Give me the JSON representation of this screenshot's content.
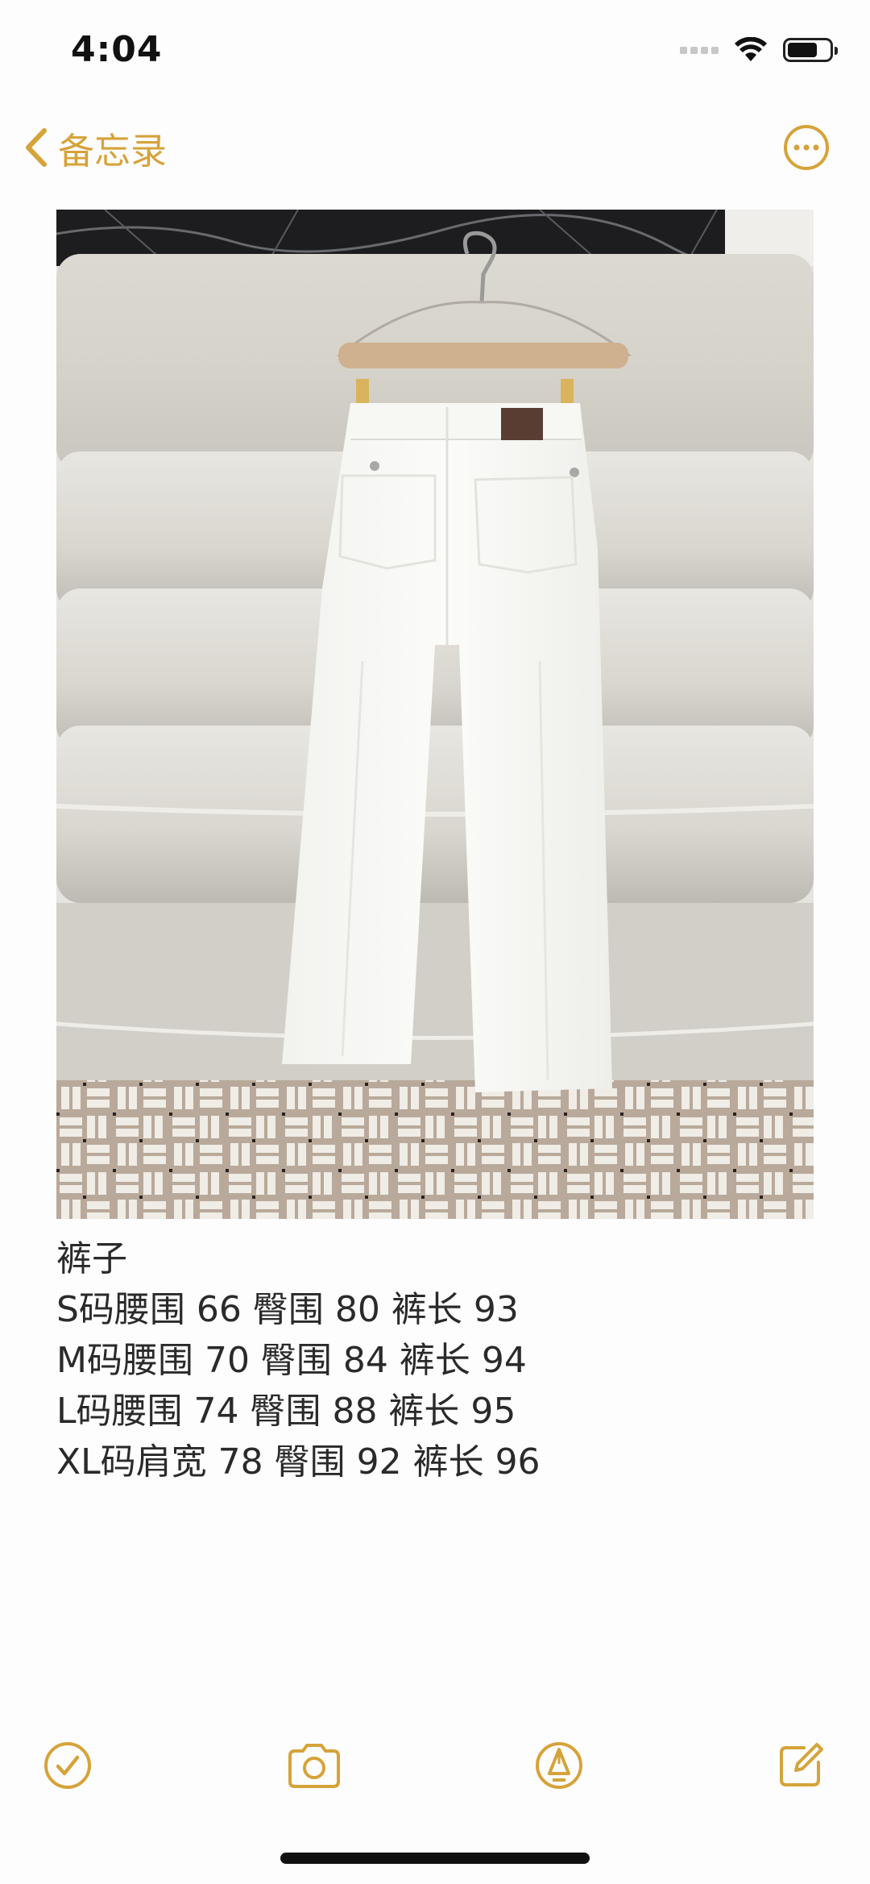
{
  "status_bar": {
    "time": "4:04"
  },
  "nav": {
    "back_label": "备忘录",
    "back_icon": "chevron-left-icon",
    "more_icon": "ellipsis-circle-icon"
  },
  "colors": {
    "accent": "#d6a33a",
    "text": "#2a2a2a",
    "background": "#fdfdfd"
  },
  "note": {
    "lines": [
      "裤子",
      "S码腰围 66 臀围 80 裤长 93",
      "M码腰围 70 臀围 84 裤长 94",
      "L码腰围 74 臀围 88 裤长 95",
      "XL码肩宽 78 臀围 92 裤长 96"
    ]
  },
  "toolbar": {
    "checklist_icon": "checkmark-circle-icon",
    "camera_icon": "camera-icon",
    "markup_icon": "pen-tip-circle-icon",
    "compose_icon": "compose-icon"
  }
}
